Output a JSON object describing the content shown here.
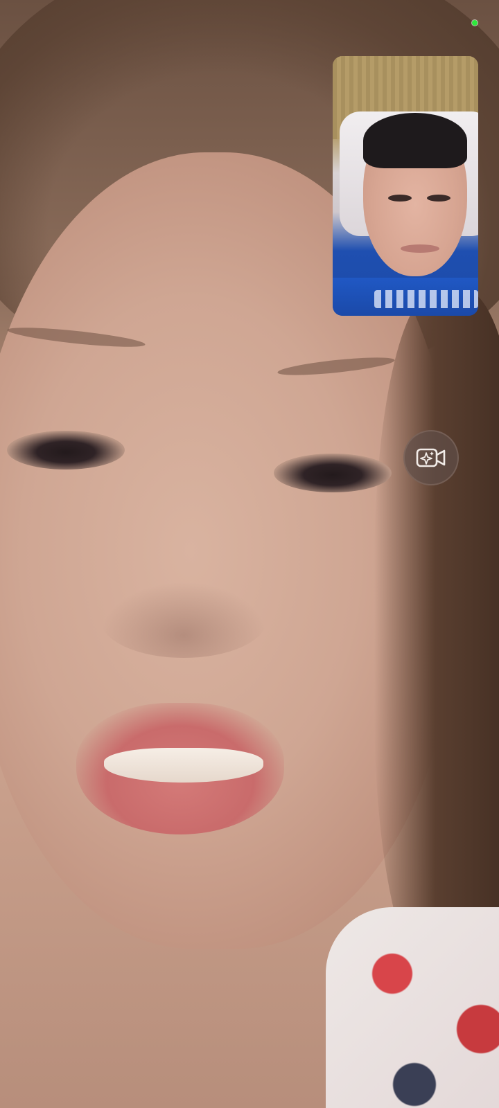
{
  "call": {
    "type": "video-call",
    "remote_feed": "remote-participant-video",
    "self_feed": "self-preview-video"
  },
  "status": {
    "camera_indicator_color": "#2ee83c"
  },
  "controls": {
    "effects_icon": "video-sparkle-icon"
  }
}
